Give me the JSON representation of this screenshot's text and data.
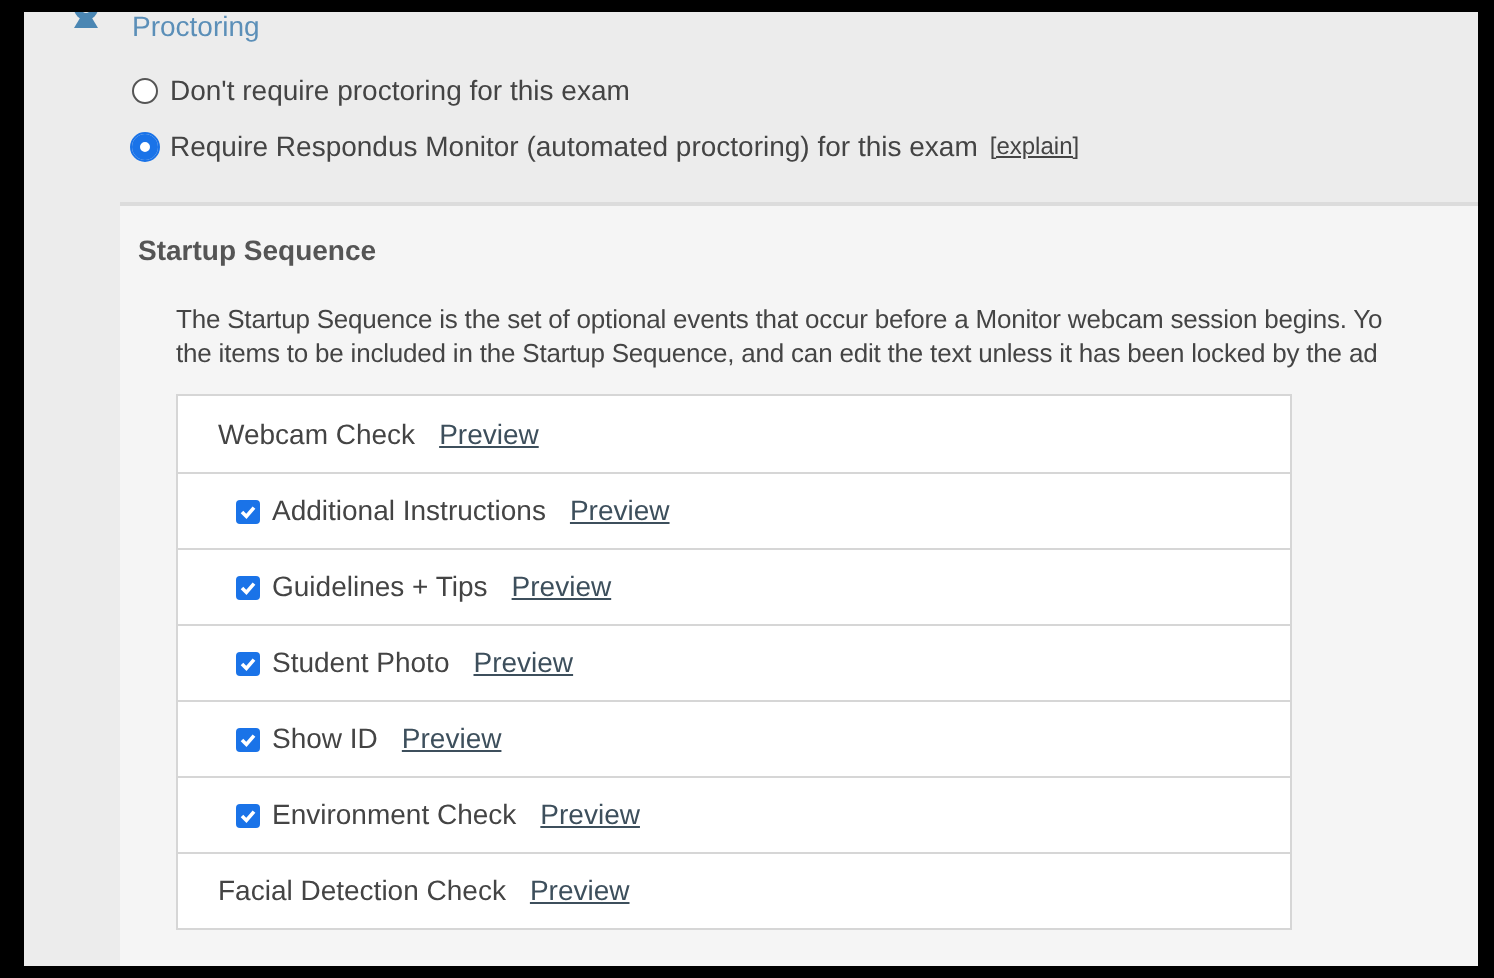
{
  "section_title": "Proctoring",
  "options": [
    {
      "label": "Don't require proctoring for this exam",
      "selected": false
    },
    {
      "label": "Require Respondus Monitor (automated proctoring) for this exam",
      "link": "[explain]",
      "selected": true
    }
  ],
  "startup": {
    "title": "Startup Sequence",
    "description_lines": [
      "The Startup Sequence is the set of optional events that occur before a Monitor webcam session begins. Yo",
      "the items to be included in the Startup Sequence, and can edit the text unless it has been locked by the ad"
    ],
    "items": [
      {
        "kind": "header",
        "label": "Webcam Check",
        "link": "Preview"
      },
      {
        "kind": "checkbox",
        "label": "Additional Instructions",
        "link": "Preview",
        "checked": true
      },
      {
        "kind": "checkbox",
        "label": "Guidelines + Tips",
        "link": "Preview",
        "checked": true
      },
      {
        "kind": "checkbox",
        "label": "Student Photo",
        "link": "Preview",
        "checked": true
      },
      {
        "kind": "checkbox",
        "label": "Show ID",
        "link": "Preview",
        "checked": true
      },
      {
        "kind": "checkbox",
        "label": "Environment Check",
        "link": "Preview",
        "checked": true
      },
      {
        "kind": "header",
        "label": "Facial Detection Check",
        "link": "Preview"
      }
    ]
  }
}
